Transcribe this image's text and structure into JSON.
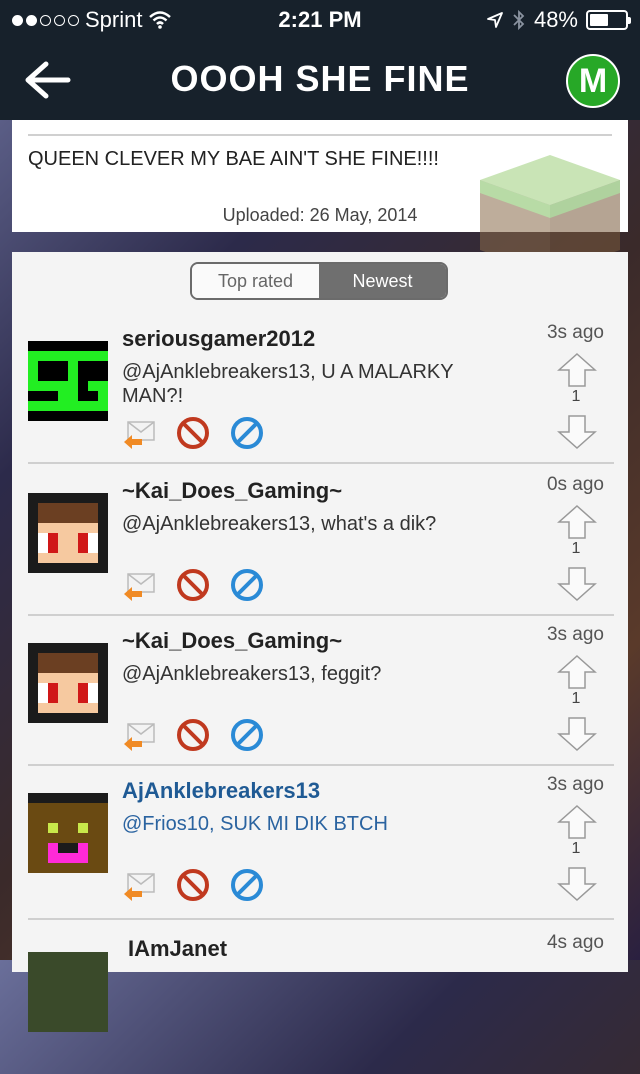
{
  "status": {
    "carrier": "Sprint",
    "time": "2:21 PM",
    "battery": "48%"
  },
  "nav": {
    "title": "OOOH SHE FINE",
    "badge": "M"
  },
  "post": {
    "description": "QUEEN CLEVER MY BAE AIN'T SHE FINE!!!!",
    "uploaded": "Uploaded: 26 May, 2014"
  },
  "sort": {
    "top_rated": "Top rated",
    "newest": "Newest"
  },
  "comments": [
    {
      "user": "seriousgamer2012",
      "text": "@AjAnklebreakers13, U A MALARKY MAN?!",
      "time": "3s ago",
      "score": "1"
    },
    {
      "user": "~Kai_Does_Gaming~",
      "text": "@AjAnklebreakers13, what's a dik?",
      "time": "0s ago",
      "score": "1"
    },
    {
      "user": "~Kai_Does_Gaming~",
      "text": "@AjAnklebreakers13, feggit?",
      "time": "3s ago",
      "score": "1"
    },
    {
      "user": "AjAnklebreakers13",
      "text": "@Frios10, SUK MI DIK BTCH",
      "time": "3s ago",
      "score": "1"
    },
    {
      "user": "IAmJanet",
      "text": "",
      "time": "4s ago",
      "score": ""
    }
  ],
  "colors": {
    "nav_bg": "#17212b",
    "badge_green": "#27a827",
    "link_blue": "#1f5a94"
  }
}
